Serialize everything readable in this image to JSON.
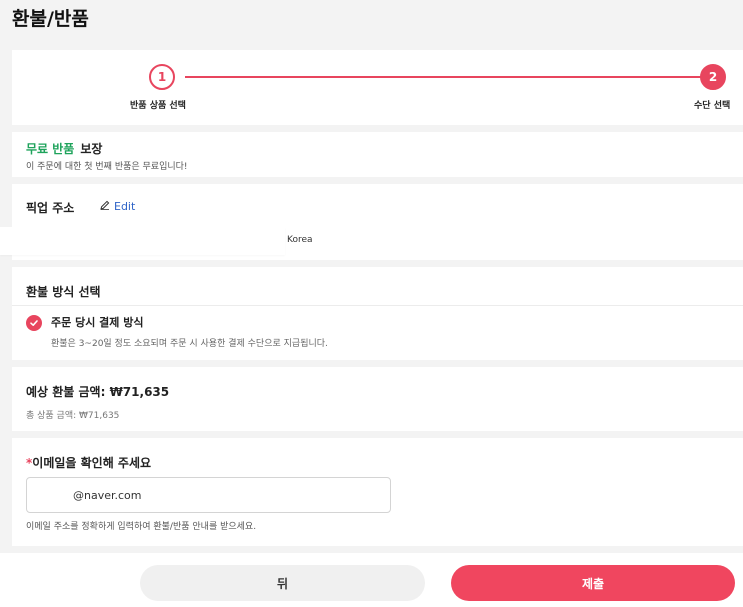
{
  "header": {
    "title": "환불/반품"
  },
  "stepper": {
    "steps": [
      {
        "number": "1",
        "label": "반품 상품 선택"
      },
      {
        "number": "2",
        "label": "수단 선택"
      }
    ],
    "accent_color": "#e8455e"
  },
  "free_return": {
    "highlight": "무료 반품",
    "title": "보장",
    "description": "이 주문에 대한 첫 번째 반품은 무료입니다!",
    "highlight_color": "#1ea35b"
  },
  "pickup": {
    "label": "픽업 주소",
    "edit_label": "Edit",
    "country": "Korea"
  },
  "refund_method": {
    "title": "환불 방식 선택",
    "option_label": "주문 당시 결제 방식",
    "option_desc": "환불은 3~20일 정도 소요되며 주문 시 사용한 결제 수단으로 지급됩니다."
  },
  "estimated": {
    "title": "예상 환불 금액: ₩71,635",
    "subtitle": "총 상품 금액: ₩71,635"
  },
  "email": {
    "required_mark": "*",
    "title": "이메일을 확인해 주세요",
    "value": "@naver.com",
    "hint": "이메일 주소를 정확하게 입력하여 환불/반품 안내를 받으세요."
  },
  "actions": {
    "back_label": "뒤",
    "submit_label": "제출",
    "submit_color": "#f0465f"
  }
}
